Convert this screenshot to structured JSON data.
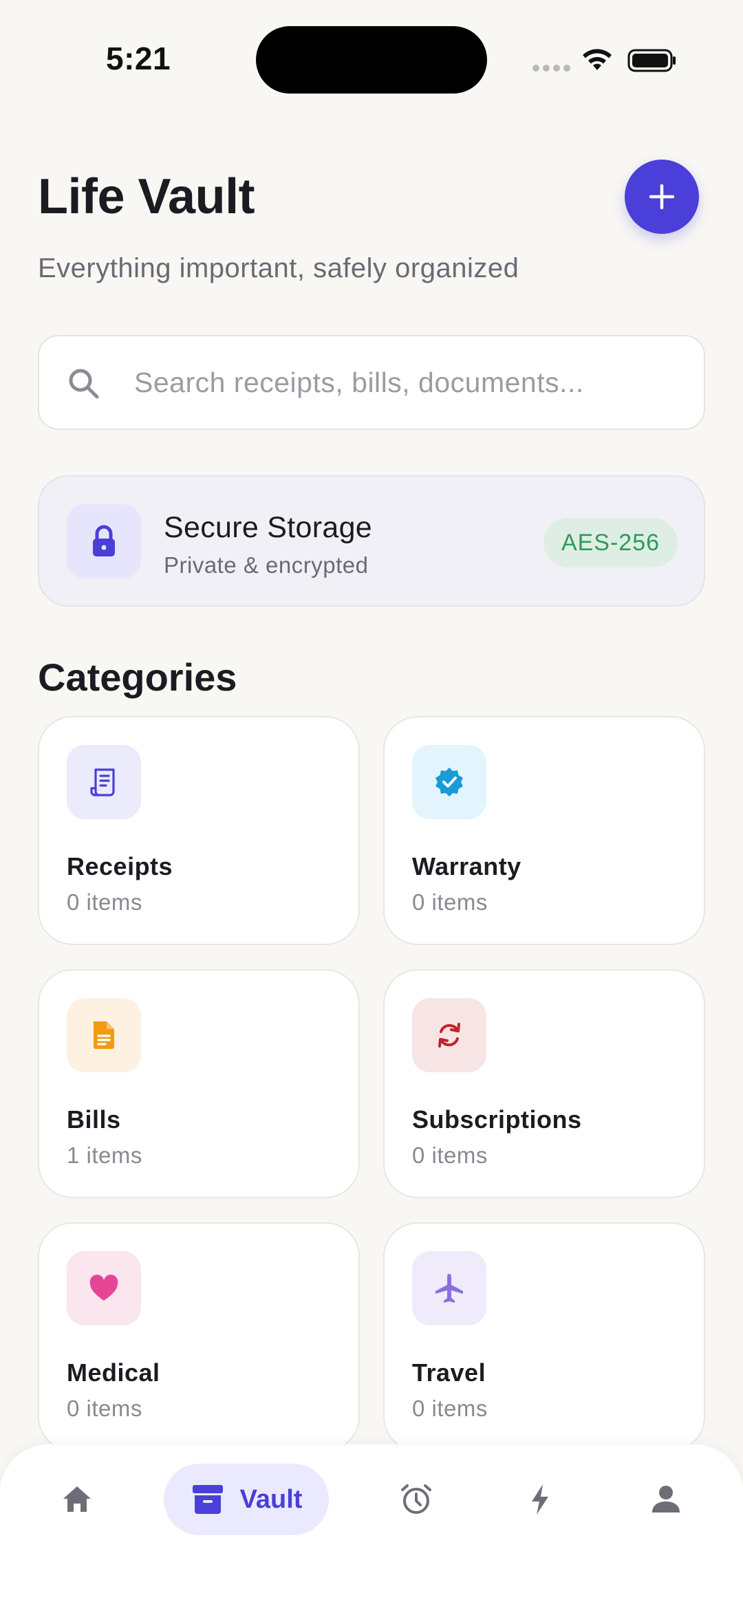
{
  "status_bar": {
    "time": "5:21"
  },
  "header": {
    "title": "Life Vault",
    "subtitle": "Everything important, safely organized"
  },
  "search": {
    "placeholder": "Search receipts, bills, documents...",
    "value": ""
  },
  "secure_card": {
    "title": "Secure Storage",
    "subtitle": "Private & encrypted",
    "badge": "AES-256"
  },
  "categories": {
    "title": "Categories",
    "items": [
      {
        "name": "Receipts",
        "count": "0 items",
        "icon": "receipt-icon",
        "color": "#4a3fd8",
        "bg": "#ebebfb"
      },
      {
        "name": "Warranty",
        "count": "0 items",
        "icon": "verified-badge-icon",
        "color": "#1a9ad6",
        "bg": "#e3f4fd"
      },
      {
        "name": "Bills",
        "count": "1 items",
        "icon": "document-icon",
        "color": "#f29b12",
        "bg": "#fdf2e2"
      },
      {
        "name": "Subscriptions",
        "count": "0 items",
        "icon": "refresh-icon",
        "color": "#c0242a",
        "bg": "#f7e5e5"
      },
      {
        "name": "Medical",
        "count": "0 items",
        "icon": "heart-icon",
        "color": "#e64595",
        "bg": "#fbe5ef"
      },
      {
        "name": "Travel",
        "count": "0 items",
        "icon": "airplane-icon",
        "color": "#8b6fe0",
        "bg": "#efebfb"
      }
    ]
  },
  "bottom_nav": {
    "items": [
      {
        "id": "home",
        "icon": "home-icon"
      },
      {
        "id": "vault",
        "icon": "archive-icon",
        "label": "Vault",
        "active": true
      },
      {
        "id": "reminders",
        "icon": "alarm-clock-icon"
      },
      {
        "id": "quick",
        "icon": "lightning-icon"
      },
      {
        "id": "profile",
        "icon": "person-icon"
      }
    ]
  },
  "colors": {
    "accent": "#4a3fd8",
    "background": "#f8f7f4",
    "badge_green": "#2f9a5a"
  }
}
